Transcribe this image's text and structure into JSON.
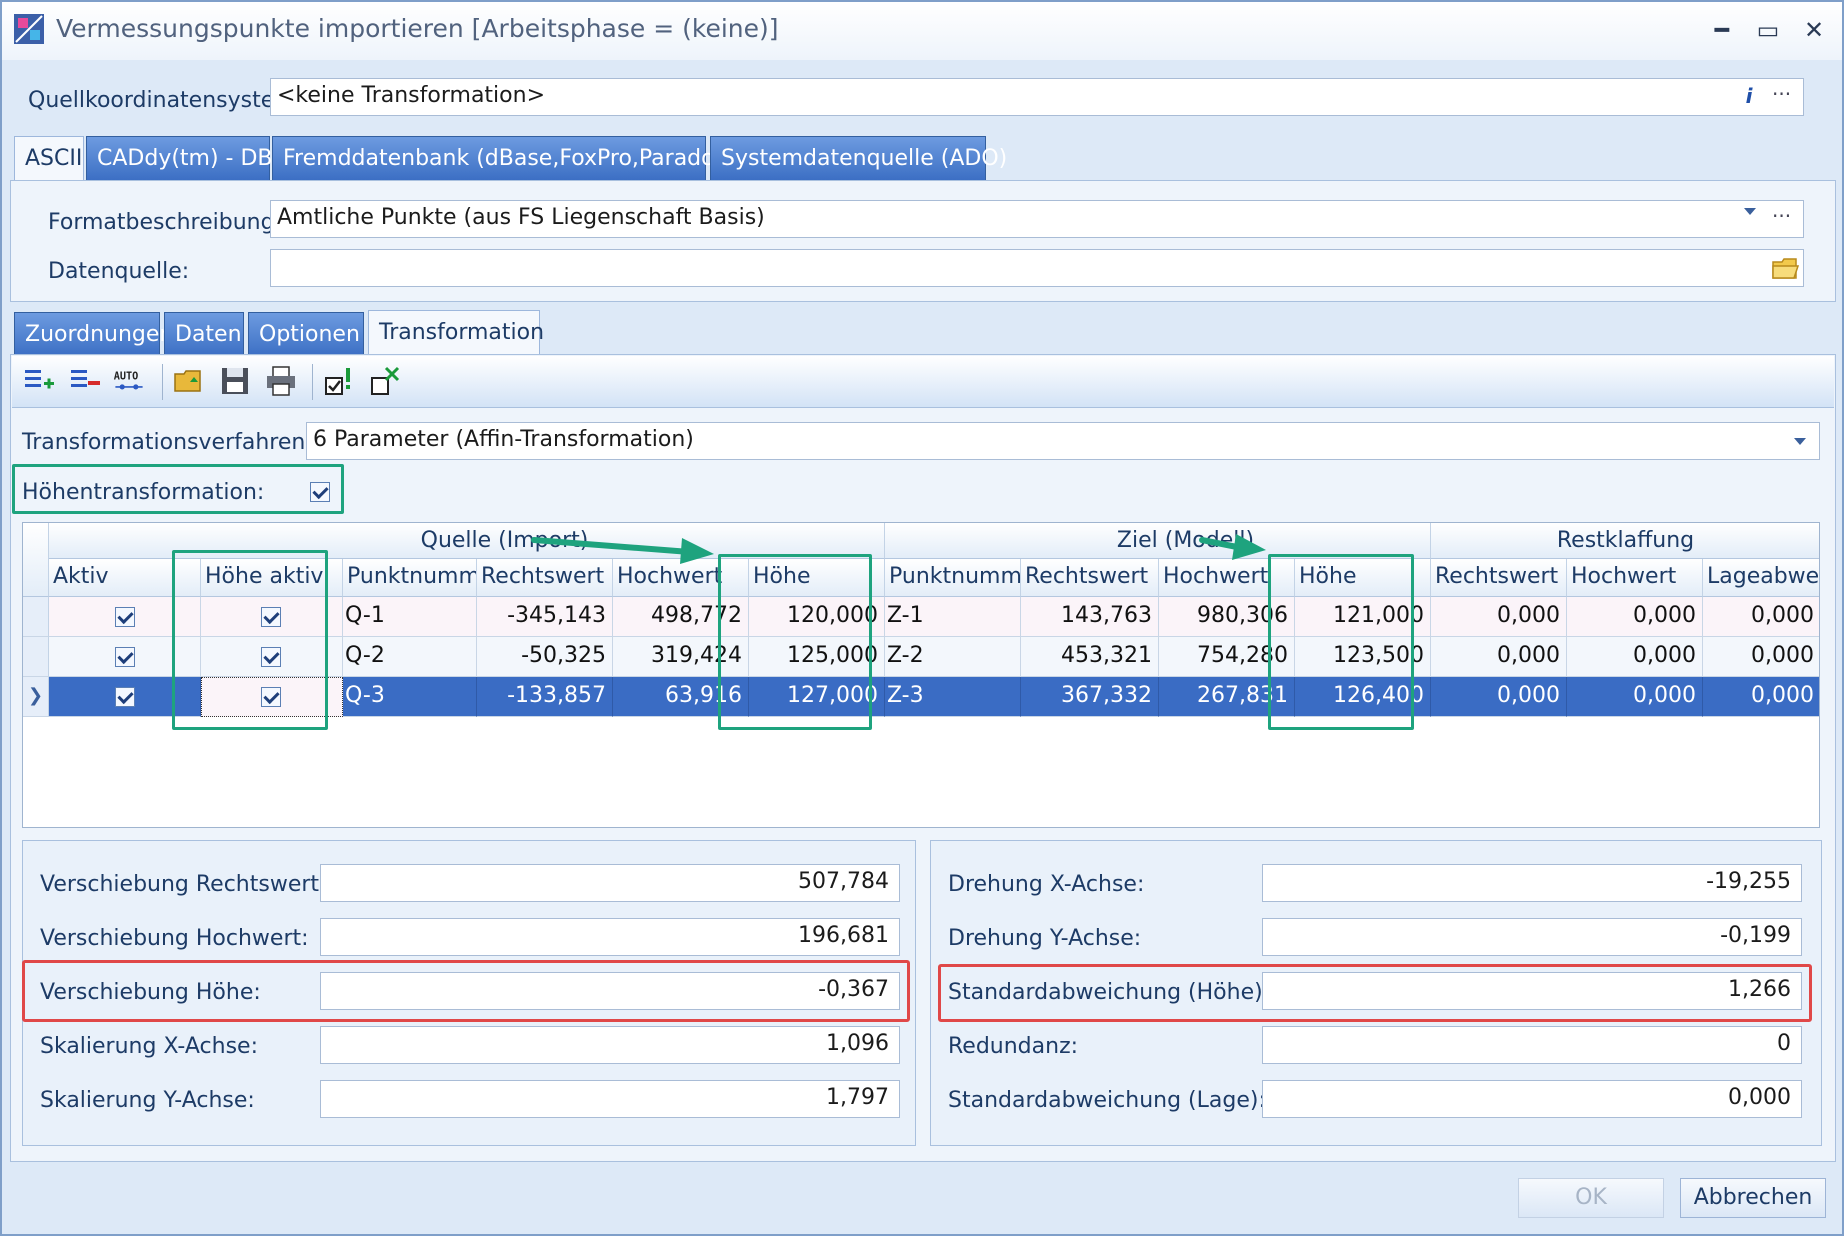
{
  "window": {
    "title": "Vermessungspunkte importieren [Arbeitsphase = (keine)]",
    "controls": {
      "minimize": "━",
      "maximize": "▭",
      "close": "✕"
    }
  },
  "source_coordinate_system": {
    "label": "Quellkoordinatensysten",
    "value": "<keine Transformation>",
    "info_icon": "i",
    "browse": "···"
  },
  "source_tabs": [
    {
      "label": "ASCII",
      "active": true
    },
    {
      "label": "CADdy(tm) - DBK",
      "active": false
    },
    {
      "label": "Fremddatenbank (dBase,FoxPro,Paradox)",
      "active": false
    },
    {
      "label": "Systemdatenquelle (ADO)",
      "active": false
    }
  ],
  "format": {
    "label": "Formatbeschreibung:",
    "value": "Amtliche Punkte (aus FS Liegenschaft Basis)",
    "browse": "···"
  },
  "datasource": {
    "label": "Datenquelle:",
    "value": ""
  },
  "inner_tabs": [
    {
      "label": "Zuordnungen",
      "active": false
    },
    {
      "label": "Daten",
      "active": false
    },
    {
      "label": "Optionen",
      "active": false
    },
    {
      "label": "Transformation",
      "active": true
    }
  ],
  "toolbar_icons": [
    "add-row-icon",
    "delete-row-icon",
    "auto-icon",
    "open-folder-icon",
    "save-icon",
    "print-icon",
    "check-all-icon",
    "uncheck-all-icon"
  ],
  "transformation": {
    "method_label": "Transformationsverfahren:",
    "method_value": "6 Parameter (Affin-Transformation)",
    "height_label": "Höhentransformation:",
    "height_checked": true
  },
  "grid": {
    "groups": {
      "source": "Quelle (Import)",
      "target": "Ziel (Modell)",
      "residual": "Restklaffung"
    },
    "columns": [
      "Aktiv",
      "Höhe aktiv",
      "Punktnumm",
      "Rechtswert",
      "Hochwert",
      "Höhe",
      "Punktnumm",
      "Rechtswert",
      "Hochwert",
      "Höhe",
      "Rechtswert",
      "Hochwert",
      "Lageabweicl"
    ],
    "rows": [
      {
        "aktiv": true,
        "hoehe_aktiv": true,
        "q_nr": "Q-1",
        "q_rw": "-345,143",
        "q_hw": "498,772",
        "q_h": "120,000",
        "z_nr": "Z-1",
        "z_rw": "143,763",
        "z_hw": "980,306",
        "z_h": "121,000",
        "r_rw": "0,000",
        "r_hw": "0,000",
        "r_la": "0,000",
        "selected": false
      },
      {
        "aktiv": true,
        "hoehe_aktiv": true,
        "q_nr": "Q-2",
        "q_rw": "-50,325",
        "q_hw": "319,424",
        "q_h": "125,000",
        "z_nr": "Z-2",
        "z_rw": "453,321",
        "z_hw": "754,280",
        "z_h": "123,500",
        "r_rw": "0,000",
        "r_hw": "0,000",
        "r_la": "0,000",
        "selected": false
      },
      {
        "aktiv": true,
        "hoehe_aktiv": true,
        "q_nr": "Q-3",
        "q_rw": "-133,857",
        "q_hw": "63,916",
        "q_h": "127,000",
        "z_nr": "Z-3",
        "z_rw": "367,332",
        "z_hw": "267,831",
        "z_h": "126,400",
        "r_rw": "0,000",
        "r_hw": "0,000",
        "r_la": "0,000",
        "selected": true
      }
    ],
    "row_pointer": "❯"
  },
  "results_left": [
    {
      "label": "Verschiebung Rechtswert:",
      "value": "507,784"
    },
    {
      "label": "Verschiebung Hochwert:",
      "value": "196,681"
    },
    {
      "label": "Verschiebung Höhe:",
      "value": "-0,367"
    },
    {
      "label": "Skalierung X-Achse:",
      "value": "1,096"
    },
    {
      "label": "Skalierung Y-Achse:",
      "value": "1,797"
    }
  ],
  "results_right": [
    {
      "label": "Drehung X-Achse:",
      "value": "-19,255"
    },
    {
      "label": "Drehung Y-Achse:",
      "value": "-0,199"
    },
    {
      "label": "Standardabweichung (Höhe):",
      "value": "1,266"
    },
    {
      "label": "Redundanz:",
      "value": "0"
    },
    {
      "label": "Standardabweichung (Lage):",
      "value": "0,000"
    }
  ],
  "buttons": {
    "ok": "OK",
    "cancel": "Abbrechen"
  },
  "colors": {
    "highlight_green": "#1ea37e",
    "highlight_red": "#e04848",
    "selection": "#3a6cc4"
  }
}
